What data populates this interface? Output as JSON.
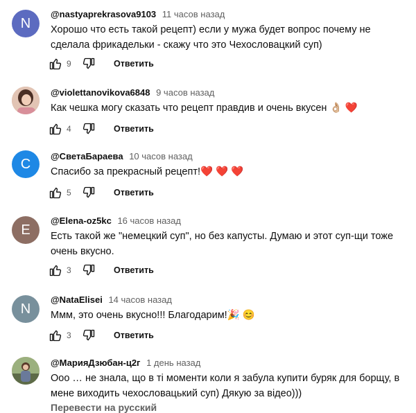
{
  "comments": [
    {
      "author": "@nastyaprekrasova9103",
      "time": "11 часов назад",
      "avatar_letter": "N",
      "avatar_color": "#5c6bc0",
      "text": "Хорошо что есть такой рецепт) если у мужа будет вопрос почему не сделала фрикадельки - скажу что это Чехословацкий суп)",
      "likes": "9",
      "reply_label": "Ответить"
    },
    {
      "author": "@violettanovikova6848",
      "time": "9 часов назад",
      "avatar_letter": "",
      "avatar_color": "#c9a28c",
      "text": "Как чешка могу сказать что рецепт правдив и очень вкусен 👌🏼 ❤️",
      "likes": "4",
      "reply_label": "Ответить"
    },
    {
      "author": "@СветаБараева",
      "time": "10 часов назад",
      "avatar_letter": "C",
      "avatar_color": "#1e88e5",
      "text": "Спасибо за прекрасный рецепт!❤️ ❤️ ❤️",
      "likes": "5",
      "reply_label": "Ответить"
    },
    {
      "author": "@Elena-oz5kc",
      "time": "16 часов назад",
      "avatar_letter": "E",
      "avatar_color": "#8d6e63",
      "text": "Есть такой же \"немецкий суп\", но без капусты. Думаю и этот суп-щи тоже очень вкусно.",
      "likes": "3",
      "reply_label": "Ответить"
    },
    {
      "author": "@NataElisei",
      "time": "14 часов назад",
      "avatar_letter": "N",
      "avatar_color": "#78909c",
      "text": "Ммм, это очень вкусно!!! Благодарим!🎉 😊",
      "likes": "3",
      "reply_label": "Ответить"
    },
    {
      "author": "@МарияДзюбан-ц2г",
      "time": "1 день назад",
      "avatar_letter": "",
      "avatar_color": "#7a8a6a",
      "text": "Ооо … не знала, що в ті моменти коли я забула купити буряк для борщу, в мене виходить чехословацький  суп) Дякую за відео)))",
      "likes": "",
      "reply_label": ""
    }
  ],
  "translate_label": "Перевести на русский"
}
